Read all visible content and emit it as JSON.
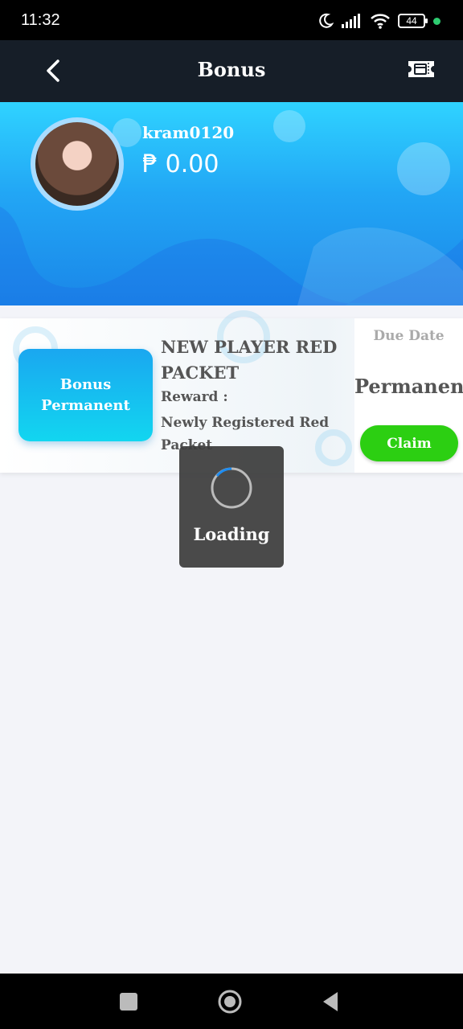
{
  "status_bar": {
    "time": "11:32",
    "battery": "44"
  },
  "header": {
    "title": "Bonus"
  },
  "profile": {
    "username": "kram0120",
    "balance": "₱ 0.00"
  },
  "bonus_card": {
    "badge_line1": "Bonus",
    "badge_line2": "Permanent",
    "title": "NEW PLAYER RED PACKET",
    "reward_label": "Reward :",
    "reward_value": "Newly Registered Red Packet",
    "due_label": "Due Date",
    "due_value": "Permanent",
    "claim_label": "Claim"
  },
  "loading": {
    "text": "Loading"
  },
  "colors": {
    "appbar": "#161e28",
    "banner_top": "#2fd3ff",
    "banner_bottom": "#1a86e8",
    "claim_button": "#2ccf12"
  },
  "icons": {
    "back": "chevron-left-icon",
    "ticket": "ticket-icon",
    "spinner": "spinner-icon",
    "moon": "moon-icon",
    "signal": "signal-icon",
    "wifi": "wifi-icon"
  }
}
